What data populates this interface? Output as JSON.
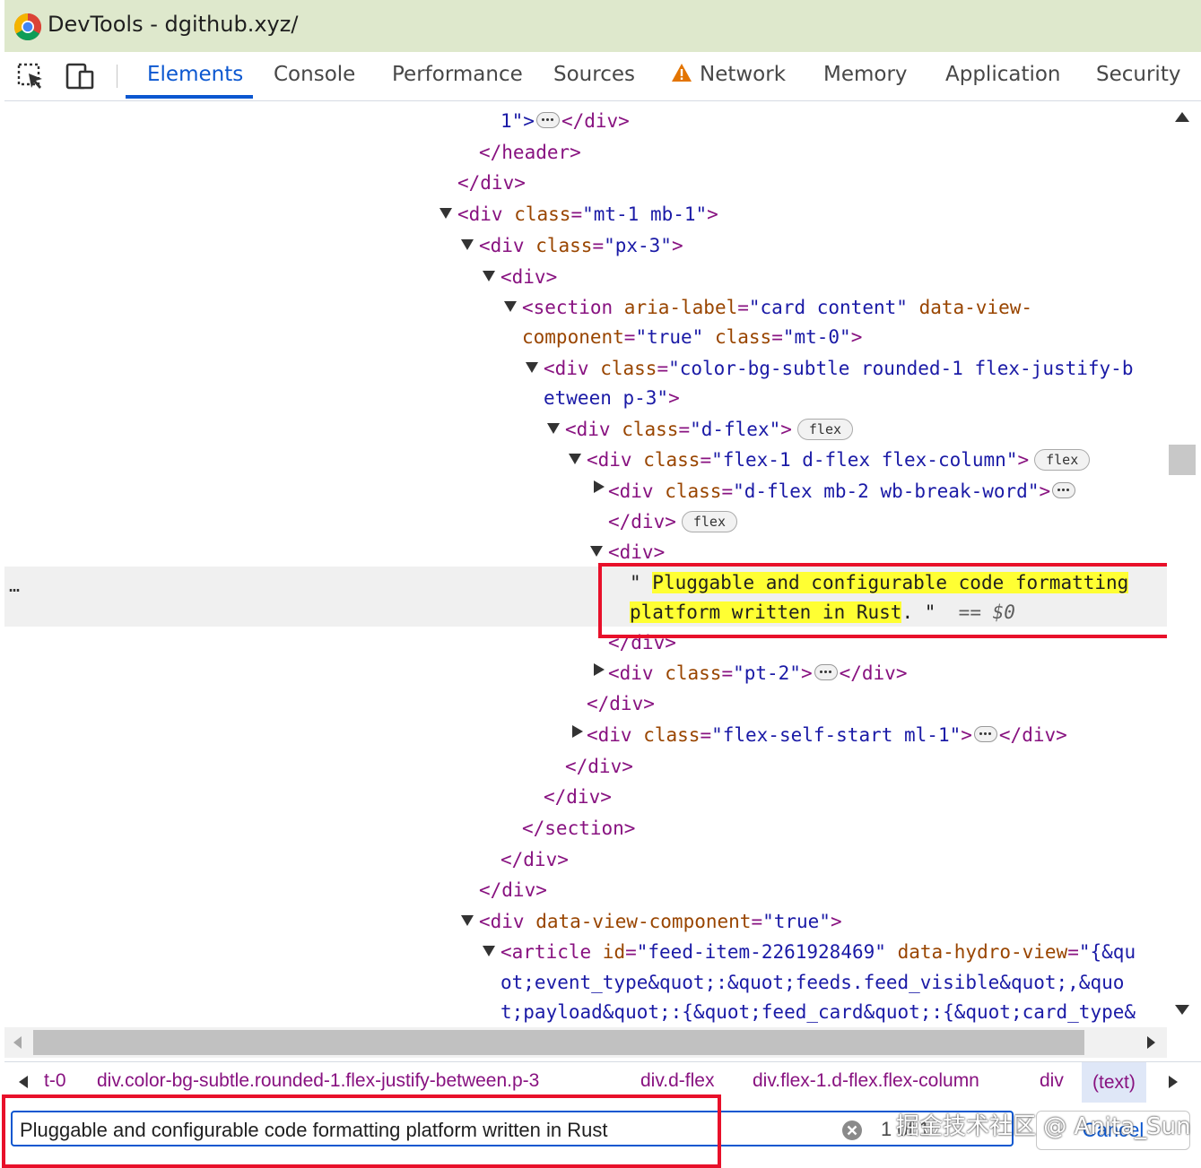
{
  "window": {
    "title": "DevTools - dgithub.xyz/"
  },
  "toolbar": {
    "inspect_icon": "inspect-element-icon",
    "device_icon": "device-toolbar-icon",
    "tabs": [
      {
        "label": "Elements",
        "active": true
      },
      {
        "label": "Console"
      },
      {
        "label": "Performance"
      },
      {
        "label": "Sources"
      },
      {
        "label": "Network",
        "icon": "warning-icon"
      },
      {
        "label": "Memory"
      },
      {
        "label": "Application"
      },
      {
        "label": "Security"
      }
    ]
  },
  "tree": {
    "l0": {
      "val_end": "1\">",
      "close": "</div>"
    },
    "l1": "</header>",
    "l2": "</div>",
    "l3": {
      "open": "<div ",
      "attr": "class",
      "val": "\"mt-1 mb-1\"",
      "end": ">"
    },
    "l4": {
      "open": "<div ",
      "attr": "class",
      "val": "\"px-3\"",
      "end": ">"
    },
    "l5": "<div>",
    "l6": {
      "open": "<section ",
      "attr1": "aria-label",
      "val1": "\"card content\"",
      "attr2": "data-view-"
    },
    "l7": {
      "attr2b": "component",
      "val2": "\"true\"",
      "attr3": "class",
      "val3": "\"mt-0\"",
      "end": ">"
    },
    "l8": {
      "open": "<div ",
      "attr": "class",
      "val": "\"color-bg-subtle rounded-1 flex-justify-b"
    },
    "l9": {
      "val": "etween p-3\"",
      "end": ">"
    },
    "l10": {
      "open": "<div ",
      "attr": "class",
      "val": "\"d-flex\"",
      "end": ">",
      "badge": "flex"
    },
    "l11": {
      "open": "<div ",
      "attr": "class",
      "val": "\"flex-1 d-flex flex-column\"",
      "end": ">",
      "badge": "flex"
    },
    "l12": {
      "open": "<div ",
      "attr": "class",
      "val": "\"d-flex mb-2 wb-break-word\"",
      "end": ">"
    },
    "l13": {
      "close": "</div>",
      "badge": "flex"
    },
    "l14": "<div>",
    "l15": {
      "quote": "\" ",
      "hl": "Pluggable and configurable code formatting"
    },
    "l16": {
      "hl": "platform written in Rust",
      "rest": ". \"",
      "marker": "== $0"
    },
    "l17": "</div>",
    "l18": {
      "open": "<div ",
      "attr": "class",
      "val": "\"pt-2\"",
      "end": ">",
      "close": "</div>"
    },
    "l19": "</div>",
    "l20": {
      "open": "<div ",
      "attr": "class",
      "val": "\"flex-self-start ml-1\"",
      "end": ">",
      "close": "</div>"
    },
    "l21": "</div>",
    "l22": "</div>",
    "l23": "</section>",
    "l24": "</div>",
    "l25": "</div>",
    "l26": {
      "open": "<div ",
      "attr": "data-view-component",
      "val": "\"true\"",
      "end": ">"
    },
    "l27": {
      "open": "<article ",
      "attr1": "id",
      "val1": "\"feed-item-2261928469\"",
      "attr2": "data-hydro-view",
      "val2": "\"{&qu"
    },
    "l28": "ot;event_type&quot;:&quot;feeds.feed_visible&quot;,&quo",
    "l29": "t;payload&quot;:{&quot;feed_card&quot;:{&quot;card_type&",
    "dots": "…"
  },
  "breadcrumbs": {
    "items": [
      "t-0",
      "div.color-bg-subtle.rounded-1.flex-justify-between.p-3",
      "div.d-flex",
      "div.flex-1.d-flex.flex-column",
      "div",
      "(text)"
    ]
  },
  "search": {
    "value": "Pluggable and configurable code formatting platform written in Rust",
    "count": "1 of 1",
    "cancel_label": "Cancel"
  },
  "watermark": "掘金技术社区 @ Anita_Sun",
  "colors": {
    "accent": "#0b57d0",
    "tag": "#881280",
    "attr": "#994500",
    "value": "#1a1aa6",
    "highlight": "#ffff33",
    "annotation": "#e8102a"
  }
}
